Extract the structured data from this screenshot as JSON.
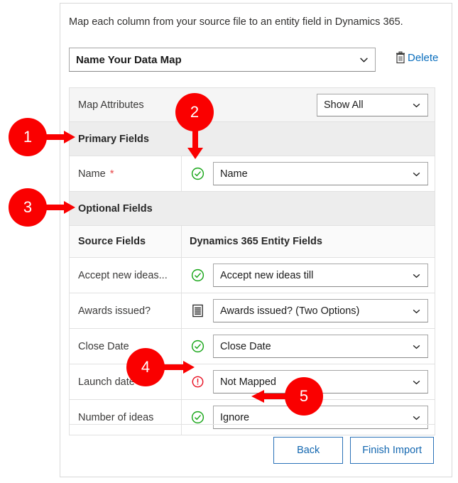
{
  "dialog": {
    "intro_text": "Map each column from your source file to an entity field in Dynamics 365.",
    "map_name_value": "Name Your Data Map",
    "delete_label": "Delete",
    "delete_icon": "trash-icon"
  },
  "table": {
    "attributes_row": {
      "label": "Map Attributes",
      "filter_value": "Show All"
    },
    "primary_section_label": "Primary Fields",
    "primary_fields": [
      {
        "source": "Name",
        "required_marker": "*",
        "status_icon": "check-circle-icon",
        "status": "mapped",
        "target": "Name"
      }
    ],
    "optional_section_label": "Optional Fields",
    "column_headers": {
      "source": "Source Fields",
      "target": "Dynamics 365 Entity Fields"
    },
    "optional_fields": [
      {
        "source": "Accept new ideas...",
        "status_icon": "check-circle-icon",
        "status": "mapped",
        "target": "Accept new ideas till"
      },
      {
        "source": "Awards issued?",
        "status_icon": "list-options-icon",
        "status": "options",
        "target": "Awards issued? (Two Options)"
      },
      {
        "source": "Close Date",
        "status_icon": "check-circle-icon",
        "status": "mapped",
        "target": "Close Date"
      },
      {
        "source": "Launch date",
        "status_icon": "error-circle-icon",
        "status": "error",
        "target": "Not Mapped"
      },
      {
        "source": "Number of ideas",
        "status_icon": "check-circle-icon",
        "status": "mapped",
        "target": "Ignore"
      }
    ]
  },
  "footer": {
    "back_label": "Back",
    "finish_label": "Finish Import"
  },
  "callouts": [
    {
      "number": "1"
    },
    {
      "number": "2"
    },
    {
      "number": "3"
    },
    {
      "number": "4"
    },
    {
      "number": "5"
    }
  ],
  "colors": {
    "callout_red": "#fa0000",
    "link_blue": "#0a6ebd",
    "button_border_blue": "#2b72b8",
    "success_green": "#16a516",
    "error_red": "#e81123",
    "required_star": "#e8484a"
  }
}
